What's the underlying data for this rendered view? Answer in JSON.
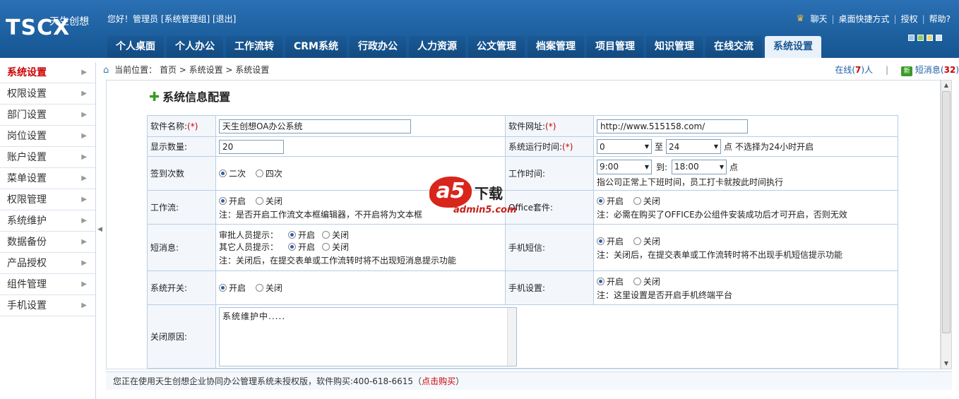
{
  "header": {
    "logo_text": "TSCX",
    "logo_sub": "天生创想",
    "greeting": "您好！管理员 [系统管理组] [退出]",
    "links": [
      "聊天",
      "桌面快捷方式",
      "授权",
      "帮助?"
    ],
    "skin_colors": [
      "#9fc3e8",
      "#8ccf5c",
      "#e8d86a",
      "#cfe4f7"
    ]
  },
  "nav": {
    "tabs": [
      "个人桌面",
      "个人办公",
      "工作流转",
      "CRM系统",
      "行政办公",
      "人力资源",
      "公文管理",
      "档案管理",
      "项目管理",
      "知识管理",
      "在线交流",
      "系统设置"
    ],
    "active": "系统设置"
  },
  "sidebar": {
    "items": [
      "系统设置",
      "权限设置",
      "部门设置",
      "岗位设置",
      "账户设置",
      "菜单设置",
      "权限管理",
      "系统维护",
      "数据备份",
      "产品授权",
      "组件管理",
      "手机设置"
    ]
  },
  "breadcrumb": {
    "label": "当前位置：",
    "path": "首页 > 系统设置 > 系统设置"
  },
  "status": {
    "online_prefix": "在线(",
    "online_count": "7",
    "online_suffix": ")人",
    "sep": "|",
    "msg_icon_text": "新",
    "msg_prefix": "短消息(",
    "msg_count": "32",
    "msg_suffix": ")"
  },
  "page": {
    "title": "系统信息配置"
  },
  "form": {
    "software_name_label": "软件名称:",
    "software_name_value": "天生创想OA办公系统",
    "software_url_label": "软件网址:",
    "software_url_value": "http://www.515158.com/",
    "display_count_label": "显示数量:",
    "display_count_value": "20",
    "run_time_label": "系统运行时间:",
    "run_time_start": "0",
    "run_time_to": "至",
    "run_time_end": "24",
    "run_time_note": "点 不选择为24小时开启",
    "signin_label": "签到次数",
    "signin_opt1": "二次",
    "signin_opt2": "四次",
    "work_time_label": "工作时间:",
    "work_time_start": "9:00",
    "work_time_to": "到:",
    "work_time_end": "18:00",
    "work_time_unit": "点",
    "work_time_note": "指公司正常上下班时间，员工打卡就按此时间执行",
    "workflow_label": "工作流:",
    "on": "开启",
    "off": "关闭",
    "workflow_note": "注：是否开启工作流文本框编辑器，不开启将为文本框",
    "office_label": "Office套件:",
    "office_note": "注：必需在购买了OFFICE办公组件安装成功后才可开启，否则无效",
    "sms_label": "短消息:",
    "sms_approver": "审批人员提示：",
    "sms_other": "其它人员提示：",
    "sms_note": "注：关闭后，在提交表单或工作流转时将不出现短消息提示功能",
    "mobile_sms_label": "手机短信:",
    "mobile_sms_note": "注：关闭后，在提交表单或工作流转时将不出现手机短信提示功能",
    "system_switch_label": "系统开关:",
    "mobile_setting_label": "手机设置:",
    "mobile_setting_note": "注：这里设置是否开启手机终端平台",
    "close_reason_label": "关闭原因:",
    "close_reason_value": "系统维护中....."
  },
  "watermark": {
    "logo": "a5",
    "text": "下载",
    "site": "admin5.com"
  },
  "footer": {
    "text": "您正在使用天生创想企业协同办公管理系统未授权版，软件购买:400-618-6615（",
    "buy": "点击购买",
    "close": "）"
  }
}
